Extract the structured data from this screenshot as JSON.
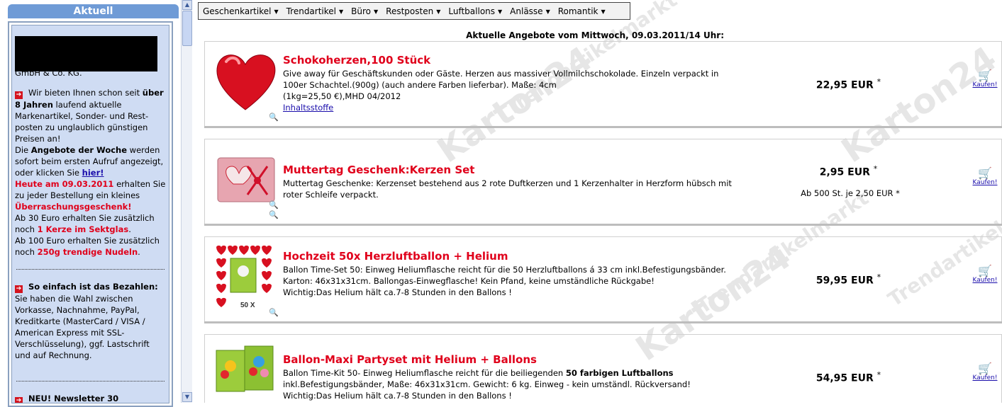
{
  "sidebar": {
    "header": "Aktuell",
    "redacted_tail": "GmbH & Co. KG.",
    "intro": {
      "p1_a": "Wir bieten Ihnen schon seit ",
      "p1_b": "über 8 Jahren",
      "p1_c": " laufend aktuelle Markenartikel, Sonder- und Rest-posten zu unglaublich günstigen Preisen an!",
      "p2_a": "Die ",
      "p2_b": "Angebote der Woche",
      "p2_c": " werden sofort beim ersten Aufruf angezeigt, oder klicken Sie ",
      "p2_link": "hier!",
      "p3_a": "Heute am 09.03.2011",
      "p3_b": " erhalten Sie zu jeder Bestellung ein kleines ",
      "p3_c": "Überraschungsgeschenk!",
      "p4_a": "Ab 30 Euro erhalten Sie zusätzlich noch ",
      "p4_b": "1 Kerze im Sektglas",
      "p4_c": ".",
      "p5_a": "Ab 100 Euro erhalten Sie zusätzlich noch ",
      "p5_b": "250g trendige Nudeln",
      "p5_c": "."
    },
    "payment": {
      "title": "So einfach ist das Bezahlen:",
      "text": "Sie haben die Wahl zwischen Vorkasse, Nachnahme, PayPal, Kreditkarte (MasterCard / VISA / American Express mit SSL-Verschlüsselung), ggf. Lastschrift und auf Rechnung."
    },
    "newsletter": {
      "title": "NEU! Newsletter 30"
    }
  },
  "menu": {
    "items": [
      "Geschenkartikel",
      "Trendartikel",
      "Büro",
      "Restposten",
      "Luftballons",
      "Anlässe",
      "Romantik"
    ]
  },
  "offers_title": "Aktuelle Angebote vom Mittwoch, 09.03.2011/14 Uhr:",
  "watermark": [
    "Trendartikelmarkt",
    "Karton24"
  ],
  "products": [
    {
      "title": "Schokoherzen,100 Stück",
      "desc": "Give away für Geschäftskunden oder Gäste. Herzen aus massiver Vollmilchschokolade. Einzeln verpackt in 100er Schachtel.(900g) (auch andere Farben lieferbar). Maße: 4cm",
      "desc2": "(1kg=25,50 €),MHD 04/2012",
      "link": "Inhaltsstoffe",
      "price": "22,95 EUR",
      "bulk": "",
      "cart_label": "Kaufen!"
    },
    {
      "title": "Muttertag Geschenk:Kerzen Set",
      "desc": "Muttertag Geschenke: Kerzenset bestehend aus 2 rote Duftkerzen und 1 Kerzenhalter in Herzform hübsch mit roter Schleife verpackt.",
      "price": "2,95 EUR",
      "bulk": "Ab 500 St. je 2,50 EUR *",
      "cart_label": "Kaufen!"
    },
    {
      "title": "Hochzeit 50x Herzluftballon + Helium",
      "desc": "Ballon Time-Set 50: Einweg Heliumflasche reicht für die 50 Herzluftballons á 33 cm inkl.Befestigungsbänder. Karton: 46x31x31cm. Ballongas-Einwegflasche! Kein Pfand, keine umständliche Rückgabe!",
      "desc2": "Wichtig:Das Helium hält ca.7-8 Stunden in den Ballons !",
      "thumb_label": "50 X",
      "price": "59,95 EUR",
      "bulk": "",
      "cart_label": "Kaufen!"
    },
    {
      "title": "Ballon-Maxi Partyset mit Helium + Ballons",
      "desc_a": "Ballon Time-Kit 50- Einweg Heliumflasche reicht für die beiliegenden ",
      "desc_b": "50 farbigen Luftballons",
      "desc_c": "inkl.Befestigungsbänder, Maße: 46x31x31cm. Gewicht: 6 kg. Einweg - kein umständl. Rückversand!",
      "desc2": "Wichtig:Das Helium hält ca.7-8 Stunden in den Ballons !",
      "price": "54,95 EUR",
      "bulk": "",
      "cart_label": "Kaufen!"
    }
  ],
  "price_star": "*",
  "colors": {
    "header_blue": "#6f9bd6",
    "sidebar_bg": "#cfdcf3",
    "title_red": "#e0001b"
  }
}
